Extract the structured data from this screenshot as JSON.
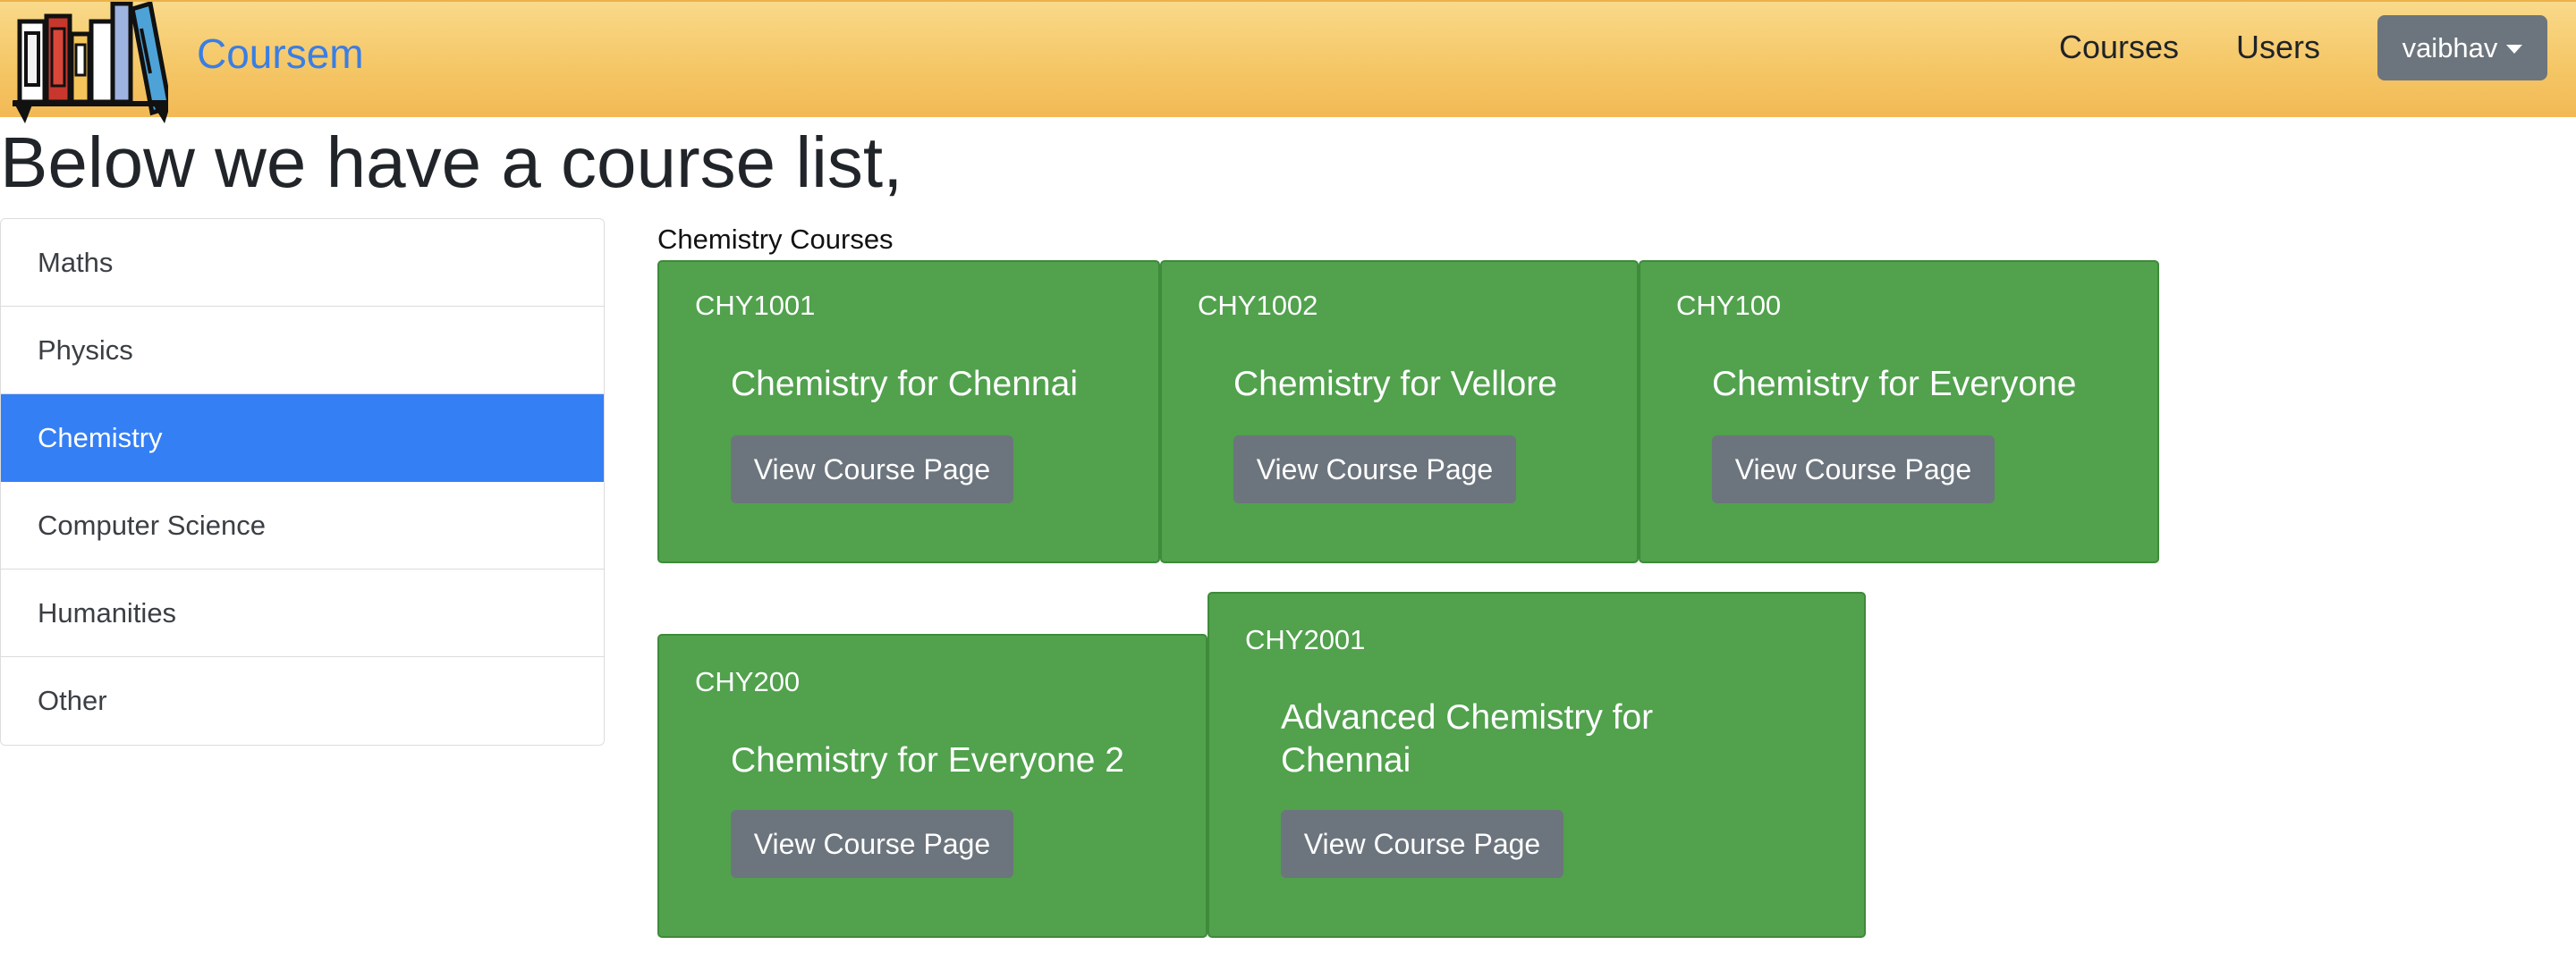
{
  "navbar": {
    "brand": "Coursem",
    "links": [
      {
        "label": "Courses"
      },
      {
        "label": "Users"
      }
    ],
    "user": "vaibhav"
  },
  "page": {
    "title": "Below we have a course list,"
  },
  "sidebar": {
    "items": [
      {
        "label": "Maths",
        "active": false
      },
      {
        "label": "Physics",
        "active": false
      },
      {
        "label": "Chemistry",
        "active": true
      },
      {
        "label": "Computer Science",
        "active": false
      },
      {
        "label": "Humanities",
        "active": false
      },
      {
        "label": "Other",
        "active": false
      }
    ]
  },
  "section": {
    "title": "Chemistry Courses",
    "cards": [
      {
        "code": "CHY1001",
        "title": "Chemistry for Chennai",
        "button": "View Course Page"
      },
      {
        "code": "CHY1002",
        "title": "Chemistry for Vellore",
        "button": "View Course Page"
      },
      {
        "code": "CHY100",
        "title": "Chemistry for Everyone",
        "button": "View Course Page"
      },
      {
        "code": "CHY200",
        "title": "Chemistry for Everyone 2",
        "button": "View Course Page"
      },
      {
        "code": "CHY2001",
        "title": "Advanced Chemistry for Chennai",
        "button": "View Course Page"
      }
    ]
  },
  "colors": {
    "card_green": "#51a14d",
    "active_blue": "#357ff5",
    "button_gray": "#6c757d",
    "brand_blue": "#3a7ee4"
  },
  "icons": {
    "logo": "books-logo-icon",
    "dropdown": "caret-down-icon"
  }
}
